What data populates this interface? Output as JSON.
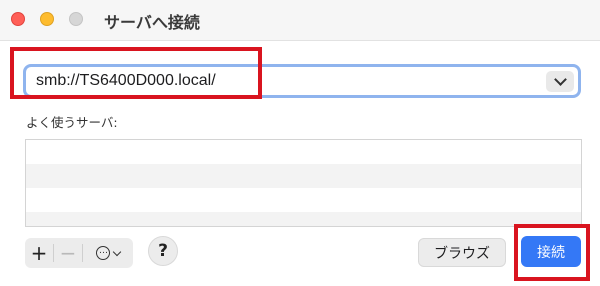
{
  "window": {
    "title": "サーバへ接続"
  },
  "address": {
    "value": "smb://TS6400D000.local/"
  },
  "favorites": {
    "label": "よく使うサーバ:",
    "items": []
  },
  "toolbar": {
    "add_label": "+",
    "remove_label": "−",
    "help_label": "?"
  },
  "buttons": {
    "browse_label": "ブラウズ",
    "connect_label": "接続"
  },
  "colors": {
    "accent": "#3478f6",
    "highlight": "#d9141f",
    "focus_ring": "#8fb4ee"
  }
}
